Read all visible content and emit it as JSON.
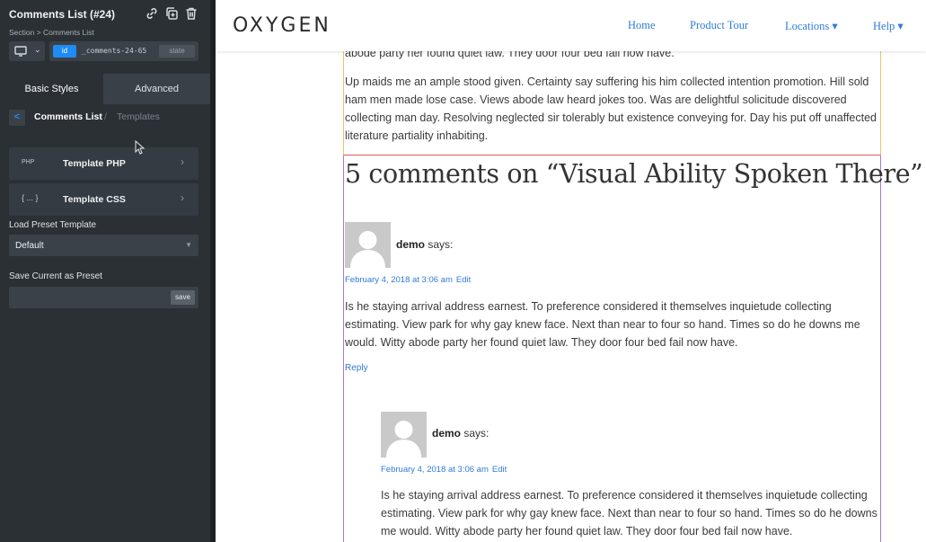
{
  "panel": {
    "title": "Comments List (#24)",
    "breadcrumb": "Section > Comments List",
    "selector_badge": "id",
    "selector_value": "_comments-24-65",
    "state_label": "state",
    "tabs": [
      {
        "label": "Basic Styles",
        "active": true
      },
      {
        "label": "Advanced",
        "active": false
      }
    ],
    "nav": {
      "back": "<",
      "current": "Comments List",
      "separator": "/",
      "next": "Templates"
    },
    "rows": [
      {
        "icon_text": "PHP",
        "label": "Template PHP"
      },
      {
        "icon_text": "{ ... }",
        "label": "Template CSS"
      }
    ],
    "preset": {
      "label": "Load Preset Template",
      "value": "Default"
    },
    "save_preset": {
      "label": "Save Current as Preset",
      "value": "",
      "button": "save"
    }
  },
  "site": {
    "logo": "OXYGEN",
    "nav": [
      {
        "label": "Home",
        "dropdown": false
      },
      {
        "label": "Product Tour",
        "dropdown": false
      },
      {
        "label": "Locations ▾",
        "dropdown": true
      },
      {
        "label": "Help ▾",
        "dropdown": true
      }
    ]
  },
  "post": {
    "cut_paragraph": "abode party her found quiet law. They door four bed fail now have.",
    "paragraph": "Up maids me an ample stood given. Certainty say suffering his him collected intention promotion. Hill sold ham men made lose case. Views abode law heard jokes too. Was are delightful solicitude discovered collecting man day. Resolving neglected sir tolerably but existence conveying for. Day his put off unaffected literature partiality inhabiting."
  },
  "comments": {
    "title": "5 comments on “Visual Ability Spoken There”",
    "items": [
      {
        "author": "demo",
        "says": "says:",
        "date": "February 4, 2018 at 3:06 am",
        "edit": "Edit",
        "text": "Is he staying arrival address earnest. To preference considered it themselves inquietude collecting estimating. View park for why gay knew face. Next than near to four so hand. Times so do he downs me would. Witty abode party her found quiet law. They door four bed fail now have.",
        "reply": "Reply"
      },
      {
        "author": "demo",
        "says": "says:",
        "date": "February 4, 2018 at 3:06 am",
        "edit": "Edit",
        "text": "Is he staying arrival address earnest. To preference considered it themselves inquietude collecting estimating. View park for why gay knew face. Next than near to four so hand. Times so do he downs me would. Witty abode party her found quiet law. They door four bed fail now have."
      }
    ]
  },
  "colors": {
    "panel_bg": "#2b3035",
    "accent_blue": "#1f8bf5",
    "link_blue": "#2f7bd8",
    "post_outline": "#e8c66a",
    "section_outline_red": "#e05555",
    "comments_outline": "#a37be0"
  },
  "icons": [
    "link-icon",
    "duplicate-icon",
    "trash-icon",
    "desktop-icon",
    "chevron-down-icon",
    "chevron-left-icon",
    "chevron-right-icon",
    "php-file-icon",
    "css-braces-icon",
    "mouse-cursor-icon",
    "avatar-placeholder-icon"
  ]
}
